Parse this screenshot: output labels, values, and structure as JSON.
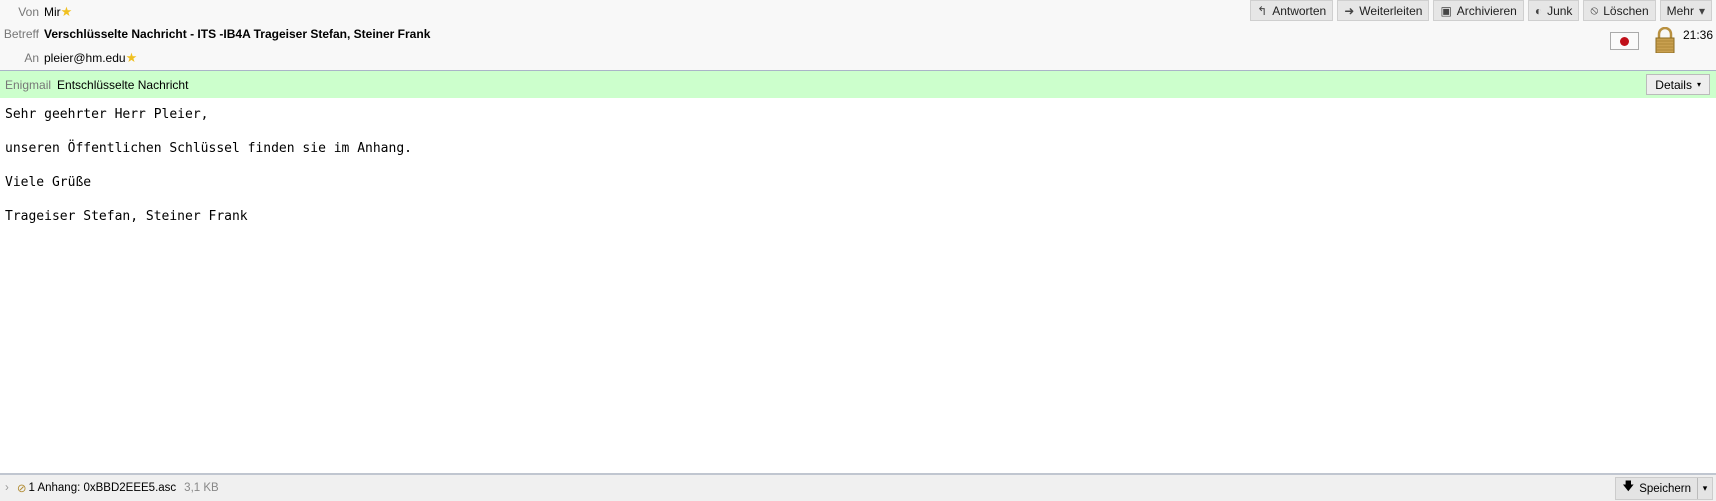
{
  "header": {
    "from_label": "Von",
    "from": "Mir",
    "subject_label": "Betreff",
    "subject": "Verschlüsselte Nachricht - ITS -IB4A Trageiser Stefan, Steiner Frank",
    "to_label": "An",
    "to": "pleier@hm.edu",
    "time": "21:36"
  },
  "toolbar": {
    "reply": "Antworten",
    "forward": "Weiterleiten",
    "archive": "Archivieren",
    "junk": "Junk",
    "delete": "Löschen",
    "more": "Mehr"
  },
  "enigmail": {
    "label": "Enigmail",
    "status": "Entschlüsselte Nachricht",
    "details": "Details"
  },
  "body": [
    "Sehr geehrter Herr Pleier,",
    "unseren Öffentlichen Schlüssel finden sie im Anhang.",
    "Viele Grüße",
    "Trageiser Stefan, Steiner Frank"
  ],
  "attachment": {
    "summary": "1 Anhang: 0xBBD2EEE5.asc",
    "size": "3,1 KB",
    "save": "Speichern"
  },
  "colors": {
    "enigmail_bg": "#ccffcc",
    "seal": "#c0101a"
  }
}
